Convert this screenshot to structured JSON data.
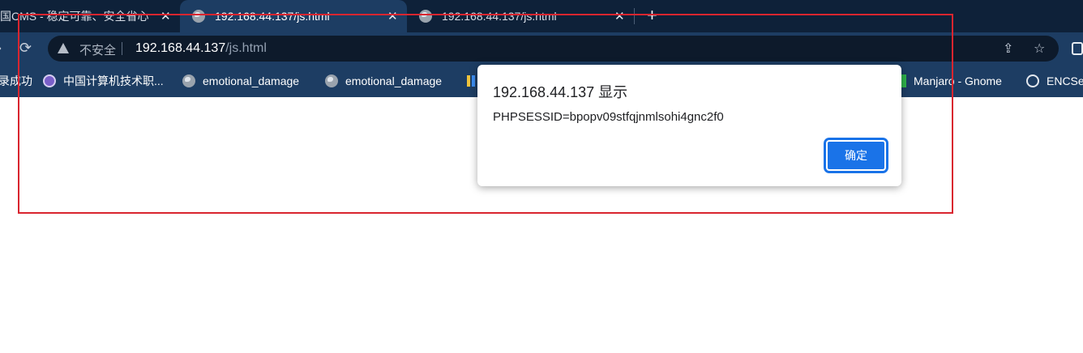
{
  "browser": {
    "tabs": [
      {
        "title": "国CMS - 稳定可靠、安全省心",
        "close": "✕"
      },
      {
        "title": "192.168.44.137/js.html",
        "close": "✕"
      },
      {
        "title": "192.168.44.137/js.html",
        "close": "✕"
      }
    ],
    "new_tab": "+",
    "address": {
      "security_label": "不安全",
      "host": "192.168.44.137",
      "path": "/js.html"
    },
    "icons": {
      "back": "arrow-left-icon",
      "reload": "reload-icon",
      "warning": "warning-icon",
      "share": "share-icon",
      "star": "star-icon",
      "extension": "extension-icon"
    },
    "bookmarks": [
      {
        "label": "录成功",
        "icon": "none"
      },
      {
        "label": "中国计算机技术职...",
        "icon": "purple-logo-icon"
      },
      {
        "label": "emotional_damage",
        "icon": "globe-icon"
      },
      {
        "label": "emotional_damage",
        "icon": "globe-icon"
      },
      {
        "label": "Manjaro - Gnome",
        "icon": "green-bar-icon"
      },
      {
        "label": "ENCSe",
        "icon": "circle-icon"
      }
    ]
  },
  "alert": {
    "title": "192.168.44.137 显示",
    "message": "PHPSESSID=bpopv09stfqjnmlsohi4gnc2f0",
    "ok_label": "确定"
  },
  "colors": {
    "tab_strip": "#0e2139",
    "toolbar": "#1d3d63",
    "omnibox": "#0d1a2b",
    "annotation_border": "#d9252f",
    "button": "#1a73e8"
  }
}
